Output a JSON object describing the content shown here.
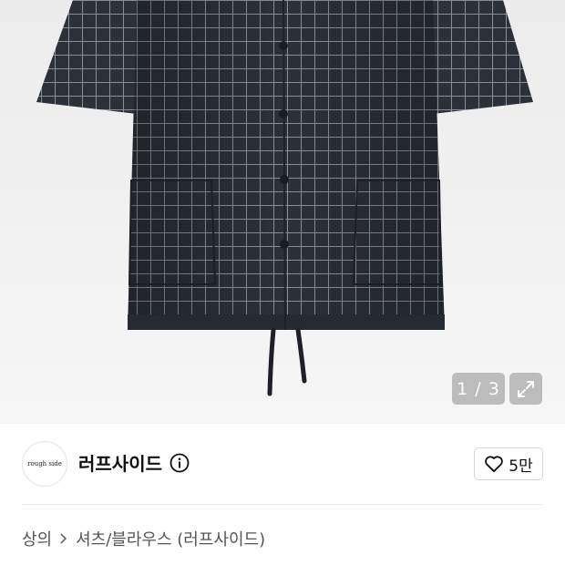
{
  "gallery": {
    "counter": "1 / 3",
    "current": 1,
    "total": 3,
    "image_subject": "navy windowpane check short-sleeve shirt",
    "expand_icon": "expand-icon"
  },
  "shop": {
    "logo_text": "rough side",
    "name": "러프사이드",
    "info_icon": "info-icon"
  },
  "like": {
    "icon": "heart-outline-icon",
    "count": "5만"
  },
  "breadcrumb": {
    "items": [
      "상의",
      "셔츠/블라우스 (러프사이드)"
    ],
    "separator_icon": "chevron-right-icon"
  },
  "colors": {
    "hero_bg": "#efefef",
    "shirt": "#2c3039",
    "text_primary": "#111111",
    "text_secondary": "#555555",
    "border": "#d6d6d6"
  }
}
